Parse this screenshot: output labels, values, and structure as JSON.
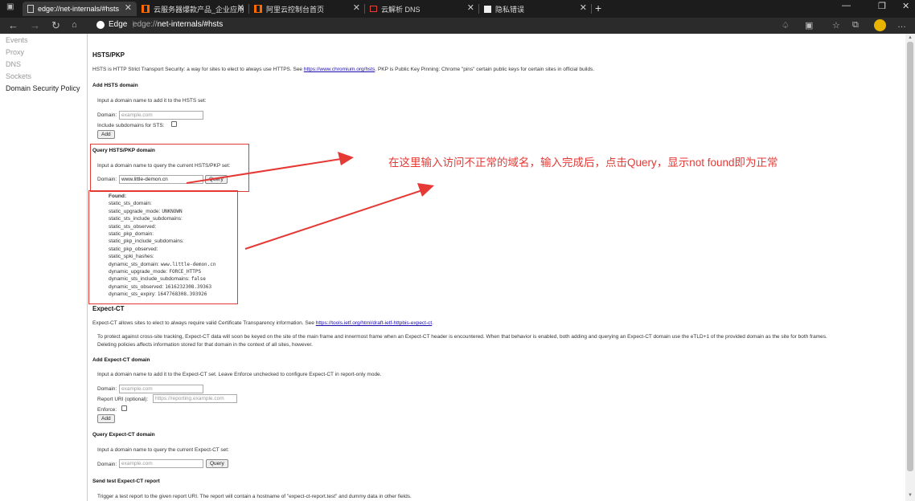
{
  "tabs": [
    {
      "title": "edge://net-internals/#hsts",
      "icon": "page-icon",
      "active": true
    },
    {
      "title": "云服务器爆款产品_企业应用产品",
      "icon": "aliyun-icon"
    },
    {
      "title": "阿里云控制台首页",
      "icon": "aliyun-icon"
    },
    {
      "title": "云解析 DNS",
      "icon": "aliyun-icon"
    },
    {
      "title": "隐私错误",
      "icon": "cert-warning-icon"
    }
  ],
  "new_tab": "+",
  "toolbar": {
    "edge_label": "Edge",
    "url_scheme": "edge://",
    "url_rest": "net-internals/#hsts"
  },
  "sidenav": [
    "Events",
    "Proxy",
    "DNS",
    "Sockets",
    "Domain Security Policy"
  ],
  "hsts": {
    "title": "HSTS/PKP",
    "desc_before": "HSTS is HTTP Strict Transport Security: a way for sites to elect to always use HTTPS. See ",
    "desc_link": "https://www.chromium.org/hsts",
    "desc_after": ". PKP is Public Key Pinning: Chrome \"pins\" certain public keys for certain sites in official builds.",
    "add_title": "Add HSTS domain",
    "add_prompt": "Input a domain name to add it to the HSTS set:",
    "domain_label": "Domain:",
    "domain_placeholder": "example.com",
    "subdomains_label": "Include subdomains for STS:",
    "add_button": "Add",
    "query_title": "Query HSTS/PKP domain",
    "query_prompt": "Input a domain name to query the current HSTS/PKP set:",
    "query_domain_label": "Domain:",
    "query_value": "www.little-demon.cn",
    "query_button": "Query",
    "result": [
      {
        "k": "Found:",
        "v": ""
      },
      {
        "k": "static_sts_domain:",
        "v": ""
      },
      {
        "k": "static_upgrade_mode:",
        "v": "UNKNOWN"
      },
      {
        "k": "static_sts_include_subdomains:",
        "v": ""
      },
      {
        "k": "static_sts_observed:",
        "v": ""
      },
      {
        "k": "static_pkp_domain:",
        "v": ""
      },
      {
        "k": "static_pkp_include_subdomains:",
        "v": ""
      },
      {
        "k": "static_pkp_observed:",
        "v": ""
      },
      {
        "k": "static_spki_hashes:",
        "v": ""
      },
      {
        "k": "dynamic_sts_domain:",
        "v": "www.little-demon.cn"
      },
      {
        "k": "dynamic_upgrade_mode:",
        "v": "FORCE_HTTPS"
      },
      {
        "k": "dynamic_sts_include_subdomains:",
        "v": "false"
      },
      {
        "k": "dynamic_sts_observed:",
        "v": "1616232308.39363"
      },
      {
        "k": "dynamic_sts_expiry:",
        "v": "1647768308.393926"
      }
    ]
  },
  "annotation": "在这里输入访问不正常的域名，输入完成后，点击Query，显示not found即为正常",
  "expect_ct": {
    "title": "Expect-CT",
    "desc_before": "Expect-CT allows sites to elect to always require valid Certificate Transparency information. See ",
    "desc_link": "https://tools.ietf.org/html/draft-ietf-httpbis-expect-ct",
    "desc_after": ".",
    "privacy_line1": "To protect against cross-site tracking, Expect-CT data will soon be keyed on the site of the main frame and innermost frame when an Expect-CT header is encountered. When that behavior is enabled, both adding and querying an Expect-CT domain use the eTLD+1 of the provided domain as the site for both frames.",
    "privacy_line2": "Deleting policies affects information stored for that domain in the context of all sites, however.",
    "add_title": "Add Expect-CT domain",
    "add_prompt": "Input a domain name to add it to the Expect-CT set. Leave Enforce unchecked to configure Expect-CT in report-only mode.",
    "domain_label": "Domain:",
    "domain_placeholder": "example.com",
    "report_label": "Report URI (optional):",
    "report_placeholder": "https://reporting.example.com",
    "enforce_label": "Enforce:",
    "add_button": "Add",
    "query_title": "Query Expect-CT domain",
    "query_prompt": "Input a domain name to query the current Expect-CT set:",
    "query_domain_label": "Domain:",
    "query_placeholder": "example.com",
    "query_button": "Query",
    "test_title": "Send test Expect-CT report",
    "test_prompt": "Trigger a test report to the given report URI. The report will contain a hostname of \"expect-ct-report.test\" and dummy data in other fields."
  },
  "colors": {
    "annotation": "#e53935",
    "link": "#1a0dab",
    "tabbar": "#1c1c1c",
    "toolbar": "#2b2b2b"
  }
}
